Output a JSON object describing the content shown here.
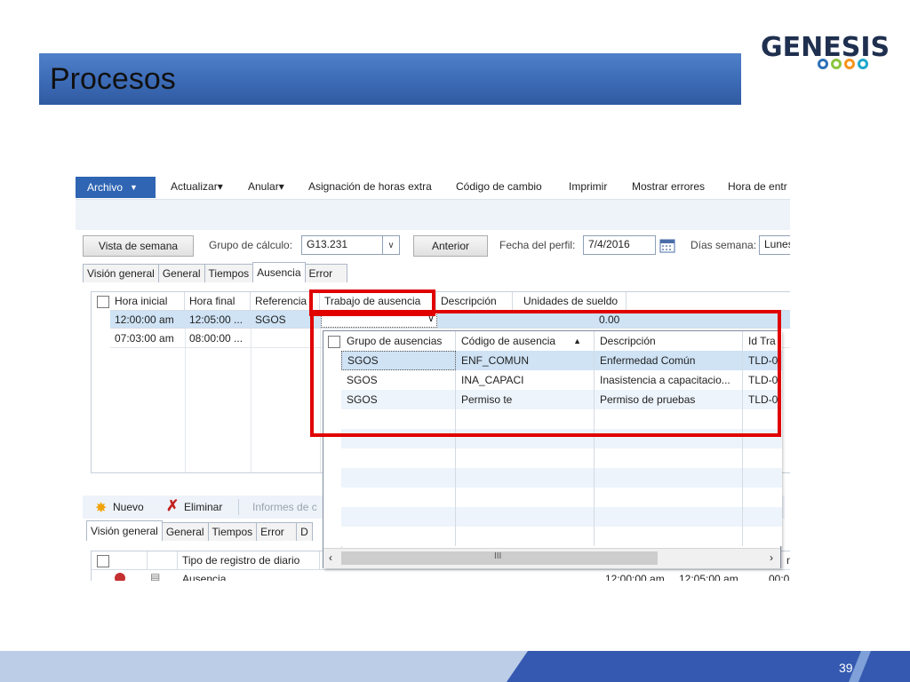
{
  "slide": {
    "title": "Procesos",
    "logo_text": "GENESIS",
    "logo_ring_colors": [
      "#2e6fb8",
      "#8cc63f",
      "#f7941d",
      "#1fa7c9"
    ],
    "page_number": "39"
  },
  "toolbar": {
    "archivo": "Archivo",
    "items": [
      "Actualizar▾",
      "Anular▾",
      "Asignación de horas extra",
      "Código de cambio",
      "Imprimir",
      "Mostrar errores",
      "Hora de entr"
    ]
  },
  "filters": {
    "vista_semana": "Vista de semana",
    "grupo_label": "Grupo de cálculo:",
    "grupo_value": "G13.231",
    "anterior": "Anterior",
    "fecha_label": "Fecha del perfil:",
    "fecha_value": "7/4/2016",
    "dias_label": "Días semana:",
    "dias_value": "Lunes"
  },
  "upper_tabs": [
    "Visión general",
    "General",
    "Tiempos",
    "Ausencia",
    "Error"
  ],
  "upper_grid": {
    "headers": [
      "Hora inicial",
      "Hora final",
      "Referencia",
      "Trabajo de ausencia",
      "Descripción",
      "Unidades de sueldo"
    ],
    "rows": [
      {
        "hora_inicial": "12:00:00 am",
        "hora_final": "12:05:00 ...",
        "referencia": "SGOS",
        "unidades": "0.00"
      },
      {
        "hora_inicial": "07:03:00 am",
        "hora_final": "08:00:00 ...",
        "referencia": "",
        "unidades": ""
      }
    ]
  },
  "popup": {
    "headers": [
      "Grupo de ausencias",
      "Código de ausencia",
      "Descripción",
      "Id Tra"
    ],
    "rows": [
      {
        "grupo": "SGOS",
        "codigo": "ENF_COMUN",
        "descripcion": "Enfermedad Común",
        "id": "TLD-0"
      },
      {
        "grupo": "SGOS",
        "codigo": "INA_CAPACI",
        "descripcion": "Inasistencia a capacitacio...",
        "id": "TLD-0"
      },
      {
        "grupo": "SGOS",
        "codigo": "Permiso te",
        "descripcion": "Permiso de pruebas",
        "id": "TLD-0"
      }
    ],
    "scroll_thumb": "III"
  },
  "lower": {
    "nuevo": "Nuevo",
    "eliminar": "Eliminar",
    "informes": "Informes de c",
    "tabs": [
      "Visión general",
      "General",
      "Tiempos",
      "Error",
      "D"
    ],
    "header_col": "Tipo de registro de diario",
    "header_right": "m",
    "row_tipo": "Ausencia",
    "row_inicio": "12:00:00 am",
    "row_fin": "12:05:00 am",
    "row_extra": "00:0"
  }
}
